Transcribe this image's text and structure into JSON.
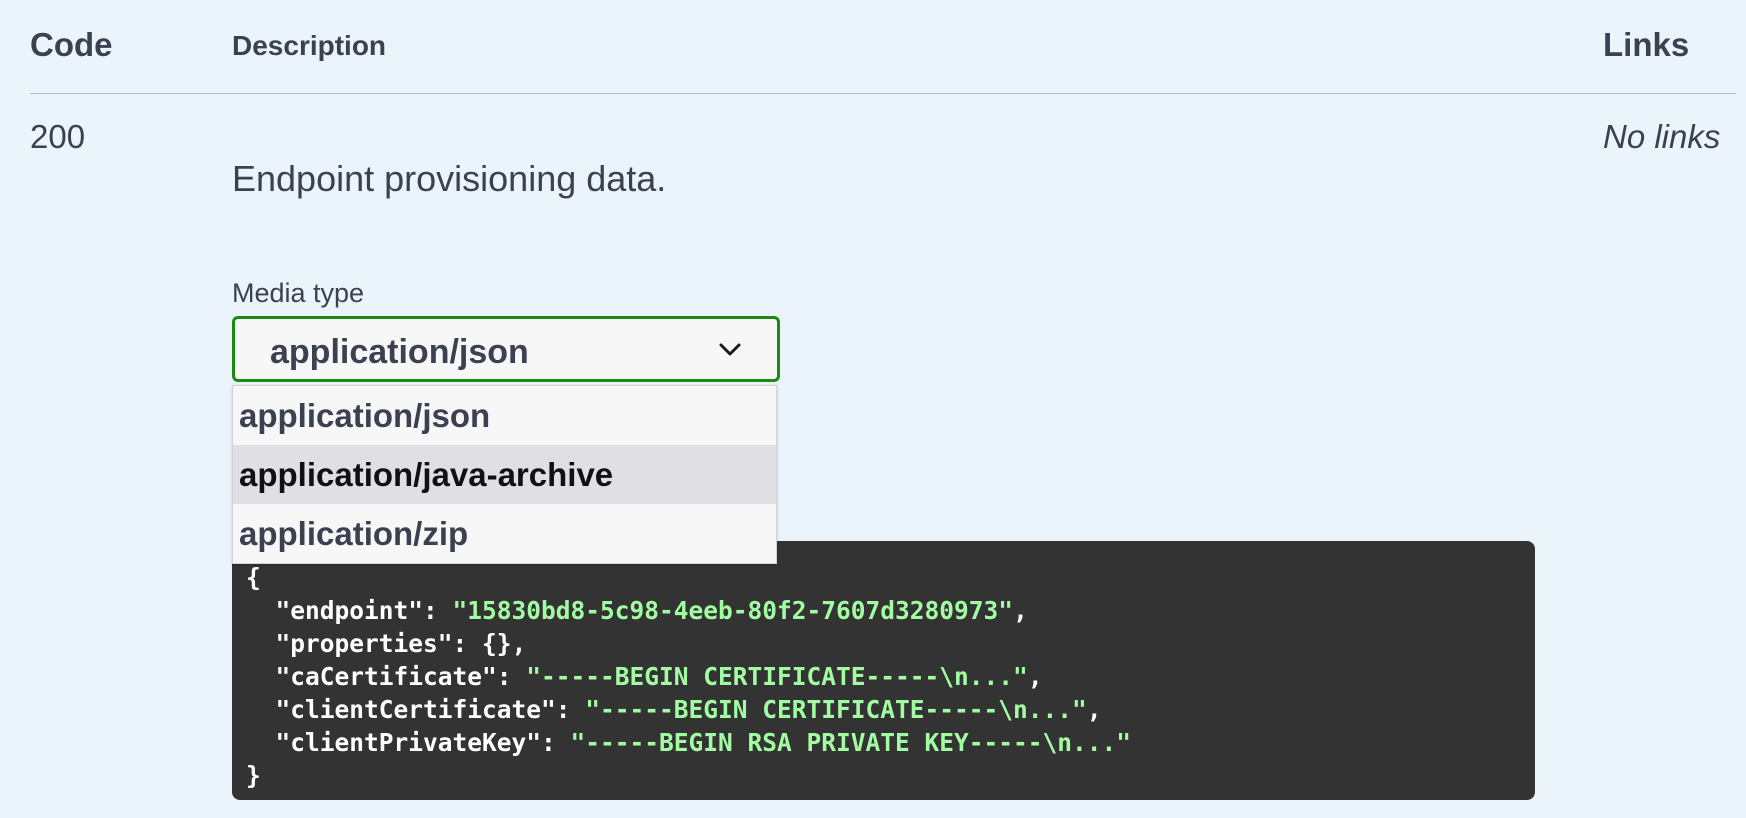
{
  "table_header": {
    "code": "Code",
    "description": "Description",
    "links": "Links"
  },
  "response": {
    "code": "200",
    "links": "No links",
    "description": "Endpoint provisioning data.",
    "media_type_label": "Media type",
    "media_type_selected": "application/json",
    "media_type_options": [
      "application/json",
      "application/java-archive",
      "application/zip"
    ],
    "highlighted_option": "application/java-archive"
  },
  "example": {
    "open": "{",
    "close": "}",
    "lines": [
      {
        "key": "\"endpoint\"",
        "sep": ": ",
        "value": "\"15830bd8-5c98-4eeb-80f2-7607d3280973\"",
        "value_is_string": true,
        "trail": ","
      },
      {
        "key": "\"properties\"",
        "sep": ": ",
        "value": "{}",
        "value_is_string": false,
        "trail": ","
      },
      {
        "key": "\"caCertificate\"",
        "sep": ": ",
        "value": "\"-----BEGIN CERTIFICATE-----\\n...\"",
        "value_is_string": true,
        "trail": ","
      },
      {
        "key": "\"clientCertificate\"",
        "sep": ": ",
        "value": "\"-----BEGIN CERTIFICATE-----\\n...\"",
        "value_is_string": true,
        "trail": ","
      },
      {
        "key": "\"clientPrivateKey\"",
        "sep": ": ",
        "value": "\"-----BEGIN RSA PRIVATE KEY-----\\n...\"",
        "value_is_string": true,
        "trail": ""
      }
    ]
  },
  "icons": {
    "select_arrow": "chevron-down-icon"
  },
  "colors": {
    "background": "#ebf3fb",
    "select_border": "#1b8a12",
    "code_bg": "#333333",
    "code_string": "#a2fca2",
    "option_highlight": "#e0dfe3"
  }
}
